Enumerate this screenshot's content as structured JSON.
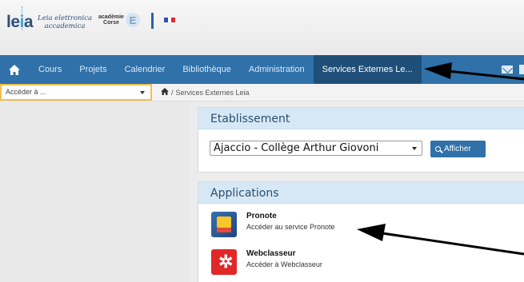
{
  "brand": {
    "logo_text_main": "le",
    "logo_text_dot": "i",
    "logo_text_end": "a",
    "logo_subtitle_line1": "Leia elettronica",
    "logo_subtitle_line2": "accademica",
    "academie_line1": "académie",
    "academie_line2": "Corse",
    "academie_letter": "E"
  },
  "nav": {
    "items": [
      {
        "label": "Cours"
      },
      {
        "label": "Projets"
      },
      {
        "label": "Calendrier"
      },
      {
        "label": "Bibliothèque"
      },
      {
        "label": "Administration"
      },
      {
        "label": "Services Externes Le..."
      }
    ],
    "home_icon": "home-icon",
    "mail_icon": "mail-icon"
  },
  "subbar": {
    "goto_placeholder": "Accéder à ...",
    "breadcrumb_separator": "/",
    "breadcrumb_current": "Services Externes Leia"
  },
  "etablissement": {
    "title": "Etablissement",
    "selected_school": "Ajaccio - Collège Arthur Giovoni",
    "button_label": "Afficher"
  },
  "applications": {
    "title": "Applications",
    "items": [
      {
        "name": "Pronote",
        "description": "Accéder au service Pronote",
        "icon": "pronote-icon"
      },
      {
        "name": "Webclasseur",
        "description": "Accéder à Webclasseur",
        "icon": "webclasseur-icon"
      }
    ]
  },
  "colors": {
    "navbar": "#2f71a8",
    "nav_active": "#1f4f78",
    "card_header": "#d6e8f6",
    "goto_border": "#f0c04d"
  }
}
